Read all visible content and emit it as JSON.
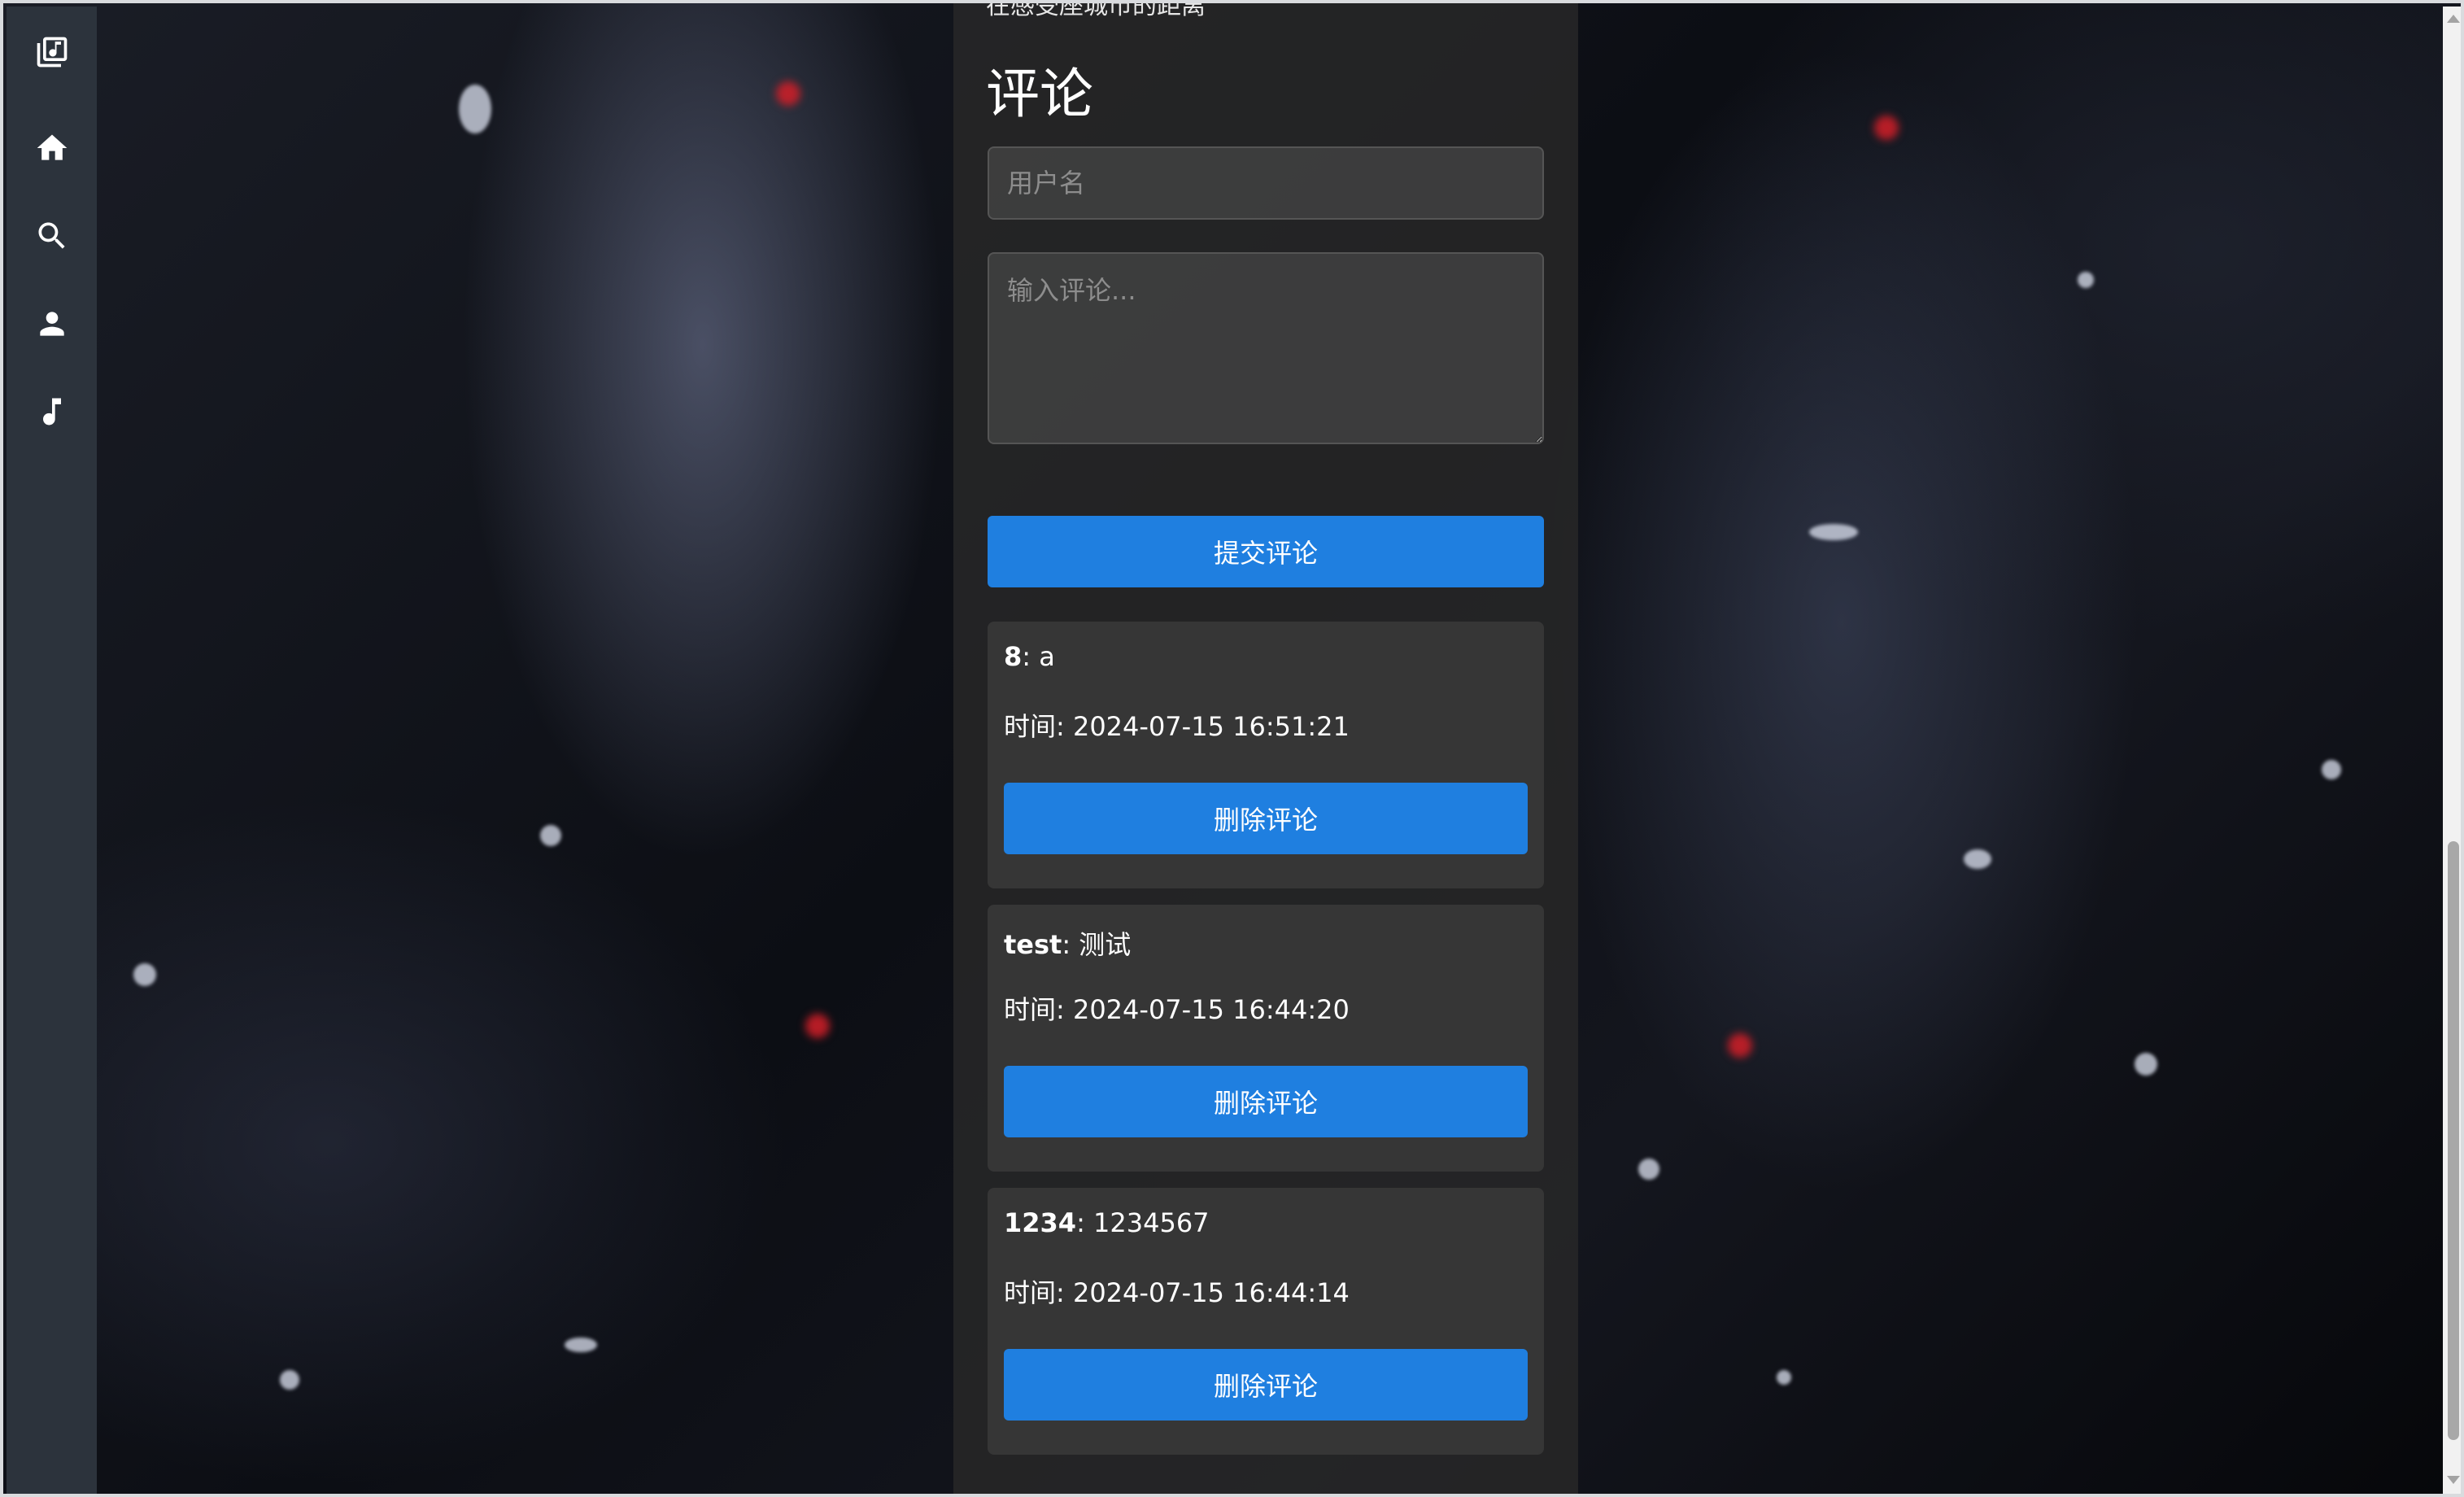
{
  "sidebar": {
    "items": [
      {
        "icon": "music-library-icon"
      },
      {
        "icon": "home-icon"
      },
      {
        "icon": "search-icon"
      },
      {
        "icon": "user-icon"
      },
      {
        "icon": "music-note-icon"
      }
    ]
  },
  "main": {
    "song_subtitle": "在感受座城市的距离",
    "comments_title": "评论",
    "form": {
      "username_placeholder": "用户名",
      "comment_placeholder": "输入评论...",
      "submit_label": "提交评论"
    },
    "comments": [
      {
        "user": "8",
        "text": "a",
        "time_label": "时间: 2024-07-15 16:51:21",
        "delete_label": "删除评论"
      },
      {
        "user": "test",
        "text": "测试",
        "time_label": "时间: 2024-07-15 16:44:20",
        "delete_label": "删除评论"
      },
      {
        "user": "1234",
        "text": "1234567",
        "time_label": "时间: 2024-07-15 16:44:14",
        "delete_label": "删除评论"
      }
    ]
  },
  "colors": {
    "sidebar_bg": "#2c333c",
    "button_blue": "#1f7fe0",
    "panel_bg": "#282828"
  }
}
